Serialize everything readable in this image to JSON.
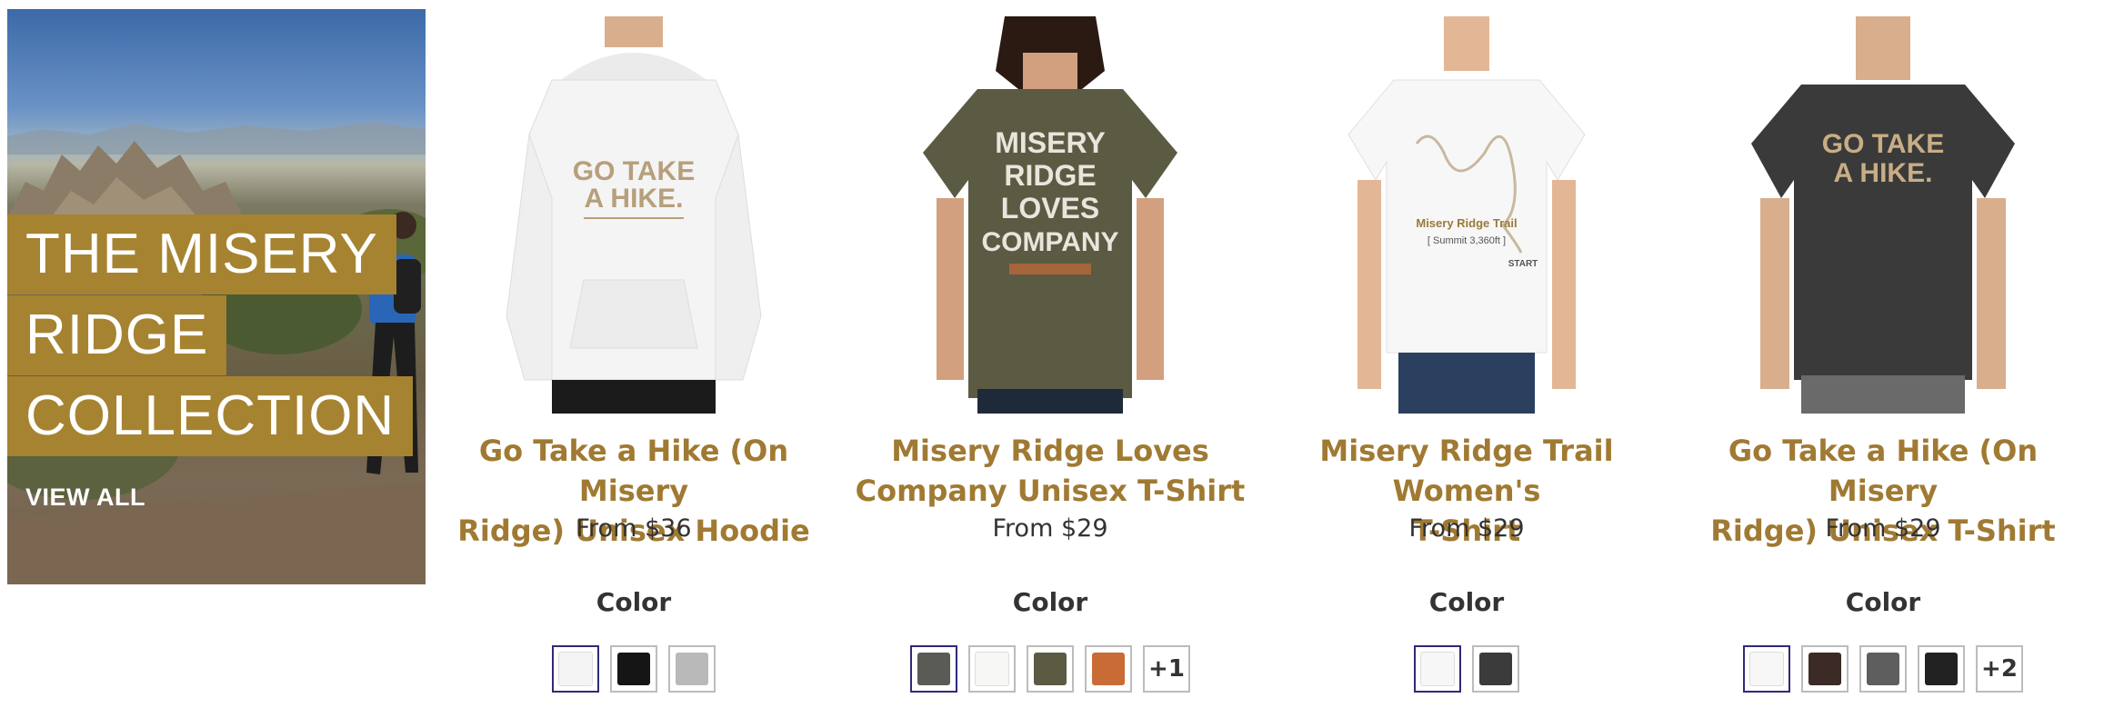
{
  "banner": {
    "line1": "THE MISERY",
    "line2": "RIDGE",
    "line3": "COLLECTION",
    "view_all": "VIEW ALL"
  },
  "products": [
    {
      "title_line1": "Go Take a Hike (On Misery",
      "title_line2": "Ridge) Unisex Hoodie",
      "price": "From $36",
      "color_label": "Color",
      "print_line1": "GO TAKE",
      "print_line2": "A HIKE.",
      "swatches": [
        "#f4f4f4",
        "#151515",
        "#b9b9b9"
      ],
      "selected_swatch": 0,
      "more_label": ""
    },
    {
      "title_line1": "Misery Ridge Loves",
      "title_line2": "Company Unisex T-Shirt",
      "price": "From $29",
      "color_label": "Color",
      "print_line1": "MISERY",
      "print_line2": "RIDGE",
      "print_line3": "LOVES",
      "print_line4": "COMPANY",
      "swatches": [
        "#5a5b55",
        "#f7f7f5",
        "#5b5a43",
        "#c96b35"
      ],
      "selected_swatch": 0,
      "more_label": "+1"
    },
    {
      "title_line1": "Misery Ridge Trail Women's",
      "title_line2": "T-Shirt",
      "price": "From $29",
      "color_label": "Color",
      "print_line1": "Misery Ridge Trail",
      "print_line2": "[ Summit 3,360ft ]",
      "print_start": "START",
      "swatches": [
        "#f7f7f7",
        "#3b3b3b"
      ],
      "selected_swatch": 0,
      "more_label": ""
    },
    {
      "title_line1": "Go Take a Hike (On Misery",
      "title_line2": "Ridge) Unisex T-Shirt",
      "price": "From $29",
      "color_label": "Color",
      "print_line1": "GO TAKE",
      "print_line2": "A HIKE.",
      "swatches": [
        "#f7f7f7",
        "#3b2a26",
        "#5e5e5e",
        "#222222"
      ],
      "selected_swatch": 0,
      "more_label": "+2"
    }
  ]
}
